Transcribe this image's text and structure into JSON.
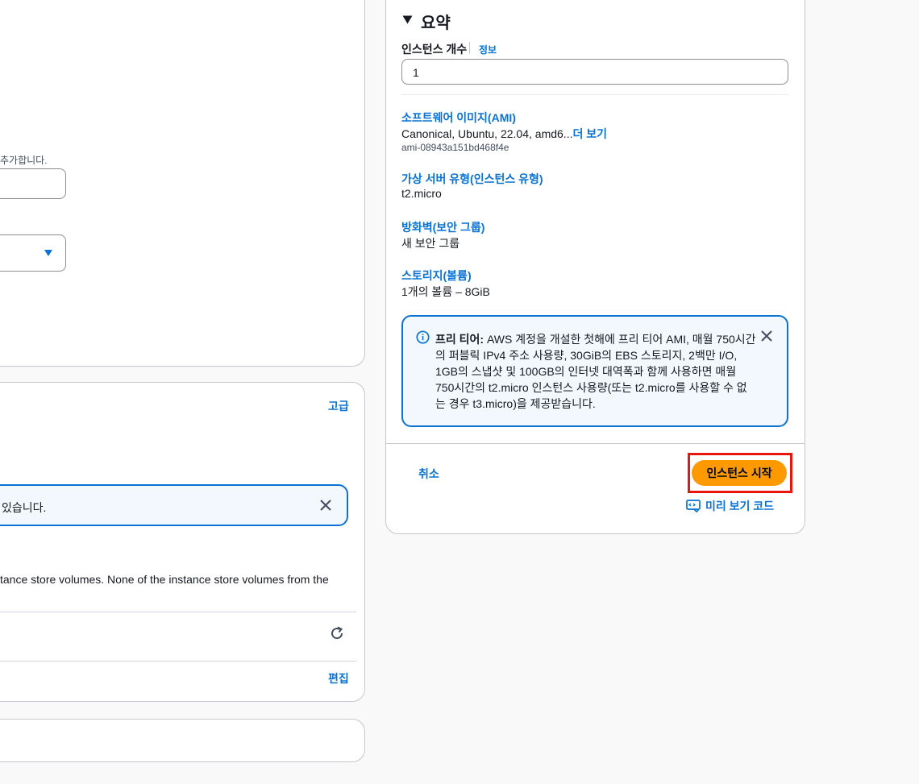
{
  "left": {
    "name_hint_tail": "추가합니다.",
    "info_alert_text": "있습니다.",
    "advanced_link": "고급",
    "instance_store_text": "tance store volumes. None of the instance store volumes from the",
    "edit_link": "편집"
  },
  "summary": {
    "title": "요약",
    "instance_count_label": "인스턴스 개수",
    "info_link": "정보",
    "instance_count_value": "1",
    "ami_label": "소프트웨어 이미지(AMI)",
    "ami_value": "Canonical, Ubuntu, 22.04, amd6...",
    "ami_more_link": "더 보기",
    "ami_id": "ami-08943a151bd468f4e",
    "instance_type_label": "가상 서버 유형(인스턴스 유형)",
    "instance_type_value": "t2.micro",
    "firewall_label": "방화벽(보안 그룹)",
    "firewall_value": "새 보안 그룹",
    "storage_label": "스토리지(볼륨)",
    "storage_value": "1개의 볼륨 – 8GiB",
    "free_tier": {
      "bold": "프리 티어:",
      "line1": "AWS 계정을 개설한 첫해에 프리 티어 AMI, 매월 750시간",
      "line2": "의 퍼블릭 IPv4 주소 사용량, 30GiB의 EBS 스토리지, 2백만 I/O,",
      "line3": "1GB의 스냅샷 및 100GB의 인터넷 대역폭과 함께 사용하면 매월",
      "line4": "750시간의 t2.micro 인스턴스 사용량(또는 t2.micro를 사용할 수 없",
      "line5": "는 경우 t3.micro)을 제공받습니다."
    },
    "cancel_button": "취소",
    "launch_button": "인스턴스 시작",
    "preview_code_link": "미리 보기 코드"
  },
  "colors": {
    "accent": "#0972d3",
    "primary_button": "#ff9900",
    "highlight": "#e8170e"
  },
  "icons": [
    "caret-down-icon",
    "triangle-down-icon",
    "info-icon",
    "close-icon",
    "refresh-icon",
    "code-preview-icon"
  ]
}
